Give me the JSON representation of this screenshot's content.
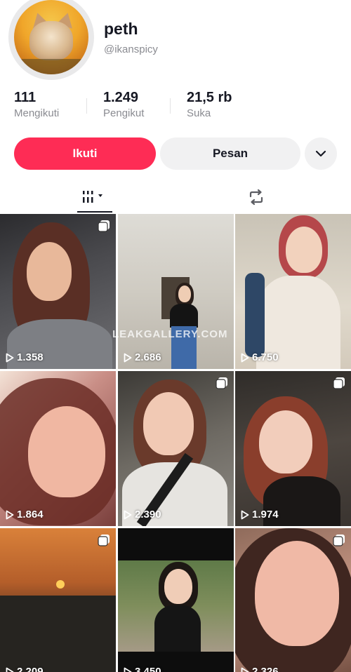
{
  "profile": {
    "username": "peth",
    "handle": "@ikanspicy"
  },
  "stats": [
    {
      "value": "111",
      "label": "Mengikuti"
    },
    {
      "value": "1.249",
      "label": "Pengikut"
    },
    {
      "value": "21,5 rb",
      "label": "Suka"
    }
  ],
  "actions": {
    "follow_label": "Ikuti",
    "message_label": "Pesan"
  },
  "tabs": {
    "videos_icon": "grid-bars-icon",
    "reposts_icon": "repost-icon"
  },
  "watermark": "LEAKGALLERY.COM",
  "videos": [
    {
      "views": "1.358",
      "multi": true
    },
    {
      "views": "2.686",
      "multi": false
    },
    {
      "views": "6.750",
      "multi": false
    },
    {
      "views": "1.864",
      "multi": false
    },
    {
      "views": "2.390",
      "multi": true
    },
    {
      "views": "1.974",
      "multi": true
    },
    {
      "views": "2.209",
      "multi": true
    },
    {
      "views": "3.450",
      "multi": false
    },
    {
      "views": "2.326",
      "multi": true
    }
  ],
  "colors": {
    "accent": "#fe2c55",
    "secondary_button": "#f1f1f2",
    "muted_text": "#8a8b91"
  }
}
